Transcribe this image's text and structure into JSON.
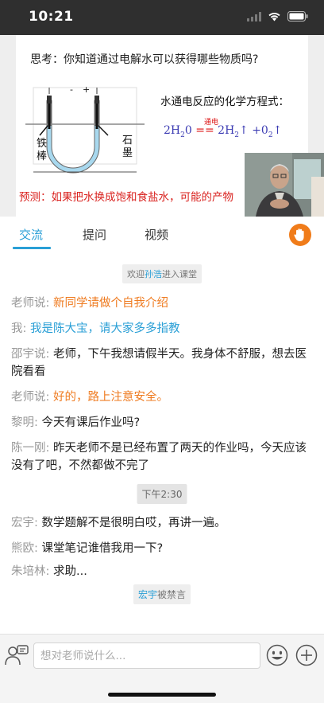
{
  "status": {
    "time": "10:21"
  },
  "slide": {
    "question": "思考：你知道通过电解水可以获得哪些物质吗?",
    "electrode_left_line1": "铁",
    "electrode_left_line2": "棒",
    "electrode_right_line1": "石",
    "electrode_right_line2": "墨",
    "polarity_minus": "-",
    "polarity_plus": "+",
    "equation_title": "水通电反应的化学方程式：",
    "equation_condition": "通电",
    "eq_lhs_coef": "2H",
    "eq_lhs_sub": "2",
    "eq_lhs_tail": "0",
    "eq_sign": "==",
    "eq_rhs1": "2H",
    "eq_rhs1_sub": "2",
    "eq_rhs2": "+0",
    "eq_rhs2_sub": "2",
    "prediction": "预测：如果把水换成饱和食盐水，可能的产物"
  },
  "tabs": [
    {
      "label": "交流",
      "active": true
    },
    {
      "label": "提问",
      "active": false
    },
    {
      "label": "视频",
      "active": false
    }
  ],
  "chat": {
    "welcome_prefix": "欢迎",
    "welcome_user": "孙浩",
    "welcome_suffix": "进入课堂",
    "messages": [
      {
        "name": "老师说:",
        "text": "新同学请做个自我介绍",
        "type": "teacher"
      },
      {
        "name": "我:",
        "text": "我是陈大宝，请大家多多指教",
        "type": "self"
      },
      {
        "name": "邵宇说:",
        "text": "老师，下午我想请假半天。我身体不舒服，想去医院看看",
        "type": "other"
      },
      {
        "name": "老师说:",
        "text": "好的，路上注意安全。",
        "type": "teacher"
      },
      {
        "name": "黎明:",
        "text": "今天有课后作业吗?",
        "type": "other"
      },
      {
        "name": "陈一刚:",
        "text": "昨天老师不是已经布置了两天的作业吗，今天应该没有了吧，不然都做不完了",
        "type": "other"
      },
      {
        "name": "宏宇:",
        "text": "数学题解不是很明白哎，再讲一遍。",
        "type": "other"
      },
      {
        "name": "熊欧:",
        "text": "课堂笔记谁借我用一下?",
        "type": "other"
      },
      {
        "name": "朱培林:",
        "text": "求助...",
        "type": "other"
      }
    ],
    "time_divider": "下午2:30",
    "muted_user": "宏宇",
    "muted_suffix": "被禁言"
  },
  "input": {
    "placeholder": "想对老师说什么..."
  },
  "colors": {
    "accent": "#2a9fd6",
    "teacher": "#ef7b20",
    "raise_hand": "#f07c1a",
    "prediction": "#d9211e"
  },
  "icons": [
    "wifi-icon",
    "battery-icon",
    "signal-icon",
    "raise-hand-icon",
    "speech-bubble-icon",
    "emoji-icon",
    "plus-icon"
  ]
}
